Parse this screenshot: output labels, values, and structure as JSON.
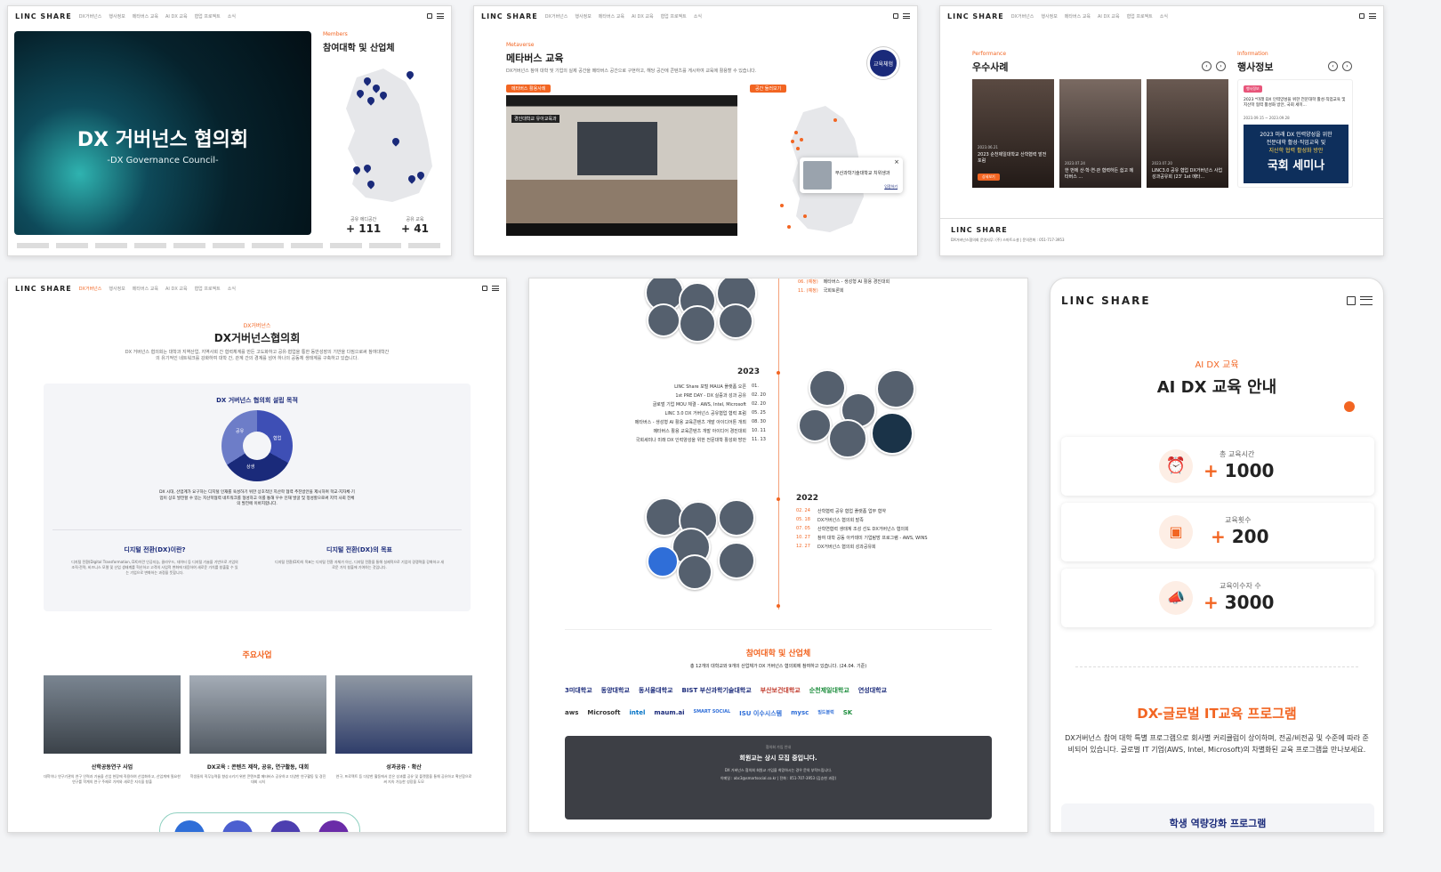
{
  "common": {
    "logo": "LINC SHARE",
    "nav": [
      "DX거버넌스",
      "행사정보",
      "메타버스 교육",
      "AI DX 교육",
      "협업 프로젝트",
      "소식"
    ]
  },
  "p1": {
    "hero_title": "DX 거버넌스 협의회",
    "hero_sub": "-DX Governance Council-",
    "label": "Members",
    "title": "참여대학 및 산업체",
    "stat1_label": "공유 에디공간",
    "stat1_value": "+ 111",
    "stat2_label": "공유 교육",
    "stat2_value": "+ 41"
  },
  "p2": {
    "label": "Metaverse",
    "title": "메타버스 교육",
    "desc": "DX거버넌스 참여 대학 및 기업의 실제 공간을 메타버스 공간으로 구현하고, 해당 공간에 콘텐츠를 게시하여 교육에 활용할 수 있습니다.",
    "btn1": "메타버스 활용사례",
    "btn2": "공간 둘러보기",
    "badge": "교육체험",
    "video_tag": "경인대학교 유아교육과",
    "popup_title": "부산과학기술대학교 치위생과",
    "popup_link": "입장하기"
  },
  "p3": {
    "perf_label": "Performance",
    "perf_title": "우수사례",
    "info_label": "Information",
    "info_title": "행사정보",
    "cards": [
      {
        "date": "2023.06.21",
        "title": "2023 순천제일대학교 산학협력 발전포럼",
        "btn": "상세보기"
      },
      {
        "date": "2023.07.24",
        "title": "한 번에 산·학·연·관 협력하든 쉽고 메타버스 ..."
      },
      {
        "date": "2023.07.20",
        "title": "LINC3.0 공유 협업 DX거버넌스 사업성과공유회 (23' 1st 메타..."
      }
    ],
    "info_tag": "행사정보",
    "info_text": "2023 *미래 DX 인력양성을 위한 전문대학 활성·직업교육 및 지산학 협력 활성화 방안, 국회 세미...",
    "info_date": "2023.09.15 ~ 2023.09.28",
    "poster1": "2023 미래 DX 인력양성을 위한",
    "poster2": "전문대학 활성·직업교육 및",
    "poster3": "지산학 협력 활성화 방안",
    "poster4": "국회 세미나",
    "footer_logo": "LINC SHARE",
    "footer_text": "DX거버넌스협의회 운영사무: (주) 스마트소셜 | 문의전화 : 051-717-3953"
  },
  "p4": {
    "label": "DX거버넌스",
    "title": "DX거버넌스협의회",
    "desc": "DX 거버넌스 협의회는 대학과 지역산업, 지역사회 간 협력체계를 만든 고도화하고 공유·협업을 통한 동반성장의 기반을 다짐으로써 참여대학간의 유기적인 네트워크를 강화하여 대학 간, 관계 간의 경계를 넘어 하나의 공동체 생태계를 구축하고 있습니다.",
    "purpose_title": "DX 거버넌스 협의회 설립 목적",
    "ring1": "공유",
    "ring2": "협업",
    "ring3": "상생",
    "purpose_desc": "DX 시대, 산업계가 요구하는 디지털 인재를 육성하기 위한 상호적인 지산학 협력 추진방안을 제시하며 학교·지자체·기업이 상호 발전할 수 있는 지산학협력 네트워크를 형성하고 이를 통해 우수 인재 발굴 및 정성할으로써 지역 사회 전체의 발전에 이바지합니다.",
    "col1_title": "디지털 전환(DX)이란?",
    "col1_text": "디지털 전환(Digital Transformation, DX)이란 인공지능, 클라우드, 데이터 등 디지털 기술을 기반으로 기업의 조직·전략, 비즈니스 모델 및 산업 생태계를 혁신하고 고객의 사업적 변화에 대응하여 새로운 가치를 창출할 수 있는 기업으로 변화하는 과정을 뜻합니다.",
    "col2_title": "디지털 전환(DX)의 목표",
    "col2_text": "디지털 전환(DX)의 목표는 디지털 전환 자체가 아닌, 디지털 전환을 통해 실제적으로 기업의 경쟁력을 강화하고 새로운 가치 창출에 기여하는 것입니다.",
    "biz_title": "주요사업",
    "biz": [
      {
        "title": "산학공동연구 사업",
        "text": "대학이나 연구기관의 연구 인력과 기술을 산업 현장에 직용하여 산업화하고, 산업계에 필요한 연구를 학계의 연구 주제로 가져와 새로운 지식을 창출"
      },
      {
        "title": "DX교육 : 콘텐츠 제작, 공유, 연구활동, 대회",
        "text": "학생들의 직무능력을 향상시키기 위한 콘텐츠를 메타버스 공유하고 다양한 연구활동 및 경진대회 시처"
      },
      {
        "title": "성과공유 · 확산",
        "text": "연구, 프로젝트 등 다양한 활동에서 얻은 성과를 공유 및 플랫폼을 통해 공유하고 확산함으로써 지속 가능한 성장을 도모"
      }
    ]
  },
  "p5": {
    "top_items": [
      {
        "date": "06. (예정)",
        "text": "메타버스 - 생성형 AI 활용 경진대회"
      },
      {
        "date": "11. (예정)",
        "text": "국회토론회"
      }
    ],
    "year1": "2023",
    "y2023": [
      {
        "text": "LINC Share 포털 MAUA 플랫폼 오픈",
        "date": "01."
      },
      {
        "text": "1st PRE DAY - DX 실증과 성과 공유",
        "date": "02. 20"
      },
      {
        "text": "글로벌 기업 MOU 체결 - AWS, Intel, Microsoft",
        "date": "02. 20"
      },
      {
        "text": "LINC 3.0 DX 거버넌스 공유협업 협력 포럼",
        "date": "05. 25"
      },
      {
        "text": "메타버스 - 생성형 AI 활용 교육콘텐츠 개발 아이디어톤 개최",
        "date": "08. 30"
      },
      {
        "text": "메타버스 활용 교육콘텐츠 개발 아이디어 경진대회",
        "date": "10. 11"
      },
      {
        "text": "국회세미나 미래 DX 인력양성을 위한 전문대학 활성화 방안",
        "date": "11. 13"
      }
    ],
    "year2": "2022",
    "y2022": [
      {
        "date": "02. 24",
        "text": "산학협력 공유 협업 플랫폼 업무 협약"
      },
      {
        "date": "05. 18",
        "text": "DX거버넌스 협의회 발족"
      },
      {
        "date": "07. 05",
        "text": "산학연협력 생태계 조성 선도 DX거버넌스 협의회"
      },
      {
        "date": "10. 27",
        "text": "참여 대학 공동 아카데미 기업탐방 프로그램 - AWS, WINS"
      },
      {
        "date": "12. 27",
        "text": "DX거버넌스 협의회 성과공유회"
      }
    ],
    "members_title": "참여대학 및 산업체",
    "members_desc": "총 12개의 대학교와 9개의 산업체가 DX 거버넌스 협의회에 참여하고 있습니다. (24.04. 기준)",
    "univ": [
      "3미대학교",
      "동양대학교",
      "동서울대학교",
      "BIST 부산과학기술대학교",
      "부산보건대학교",
      "순천제일대학교",
      "연성대학교"
    ],
    "corp": [
      "aws",
      "Microsoft",
      "intel",
      "maum.ai",
      "SMART SOCIAL",
      "ISU 이수시스템",
      "mysc",
      "빌드블럭",
      "SK"
    ],
    "join_label": "협의회 가입 안내",
    "join_title": "회원교는 상시 모집 중입니다.",
    "join_text": "DX 거버넌스 협의회 회원교 가입을 희망하시는 경우 문의 부탁드립니다.",
    "join_contact": "이메일 : abc3@smartsocial.co.kr | 전화 : 051-707-3953 (김승현 과장)"
  },
  "p6": {
    "logo": "LINC SHARE",
    "label": "AI DX 교육",
    "title": "AI DX 교육 안내",
    "stats": [
      {
        "label": "총 교육시간",
        "value": "1000"
      },
      {
        "label": "교육횟수",
        "value": "200"
      },
      {
        "label": "교육이수자 수",
        "value": "3000"
      }
    ],
    "program_title": "DX-글로벌 IT교육 프로그램",
    "program_text": "DX거버넌스 참여 대학 특별 프로그램으로 회사별 커리큘럼이 상이하며, 전공/비전공 및 수준에 따라 준비되어 있습니다. 글로벌 IT 기업(AWS, Intel, Microsoft)의 차별화된 교육 프로그램을 만나보세요.",
    "sub_title": "학생 역량강화 프로그램"
  },
  "colors": {
    "accent": "#f26522",
    "navy": "#1a2a7a"
  }
}
